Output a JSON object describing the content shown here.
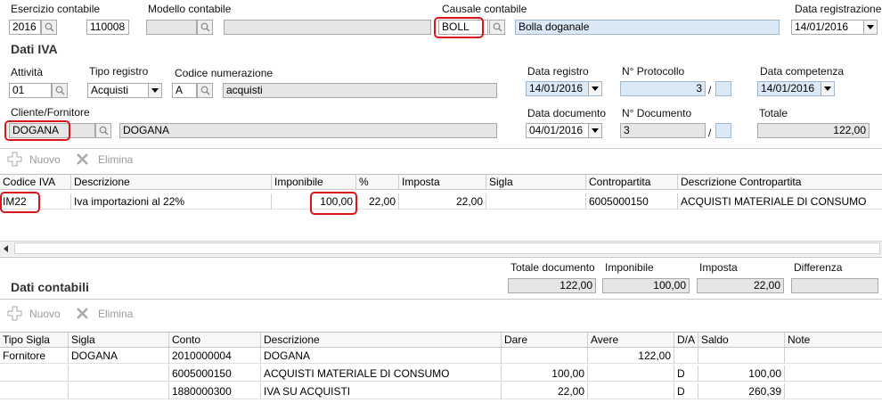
{
  "header": {
    "esercizio_label": "Esercizio contabile",
    "esercizio_value": "2016",
    "esercizio_code": "110008",
    "modello_label": "Modello contabile",
    "modello_value": "",
    "modello_desc": "",
    "causale_label": "Causale contabile",
    "causale_value": "BOLL",
    "causale_desc": "Bolla doganale",
    "data_reg_label": "Data registrazione",
    "data_reg_value": "14/01/2016"
  },
  "iva": {
    "title": "Dati IVA",
    "attivita_label": "Attività",
    "attivita_value": "01",
    "tipo_registro_label": "Tipo registro",
    "tipo_registro_value": "Acquisti",
    "codice_num_label": "Codice numerazione",
    "codice_num_value": "A",
    "codice_num_desc": "acquisti",
    "data_registro_label": "Data registro",
    "data_registro_value": "14/01/2016",
    "protocollo_label": "N° Protocollo",
    "protocollo_value": "3",
    "protocollo_sep": "/",
    "data_comp_label": "Data competenza",
    "data_comp_value": "14/01/2016",
    "cliente_label": "Cliente/Fornitore",
    "cliente_value": "DOGANA",
    "cliente_desc": "DOGANA",
    "data_doc_label": "Data documento",
    "data_doc_value": "04/01/2016",
    "num_doc_label": "N° Documento",
    "num_doc_value": "3",
    "num_doc_sep": "/",
    "totale_label": "Totale",
    "totale_value": "122,00"
  },
  "toolbar1": {
    "nuovo": "Nuovo",
    "elimina": "Elimina"
  },
  "iva_grid": {
    "columns": [
      "Codice IVA",
      "Descrizione",
      "Imponibile",
      "%",
      "Imposta",
      "Sigla",
      "Contropartita",
      "Descrizione Contropartita"
    ],
    "rows": [
      [
        "IM22",
        "Iva importazioni al 22%",
        "100,00",
        "22,00",
        "22,00",
        "",
        "6005000150",
        "ACQUISTI MATERIALE DI CONSUMO"
      ]
    ]
  },
  "totals": {
    "totale_doc_label": "Totale documento",
    "totale_doc_value": "122,00",
    "imponibile_label": "Imponibile",
    "imponibile_value": "100,00",
    "imposta_label": "Imposta",
    "imposta_value": "22,00",
    "differenza_label": "Differenza",
    "differenza_value": ""
  },
  "contabili": {
    "title": "Dati contabili"
  },
  "toolbar2": {
    "nuovo": "Nuovo",
    "elimina": "Elimina"
  },
  "cont_grid": {
    "columns": [
      "Tipo Sigla",
      "Sigla",
      "Conto",
      "Descrizione",
      "Dare",
      "Avere",
      "D/A",
      "Saldo",
      "Note"
    ],
    "rows": [
      [
        "Fornitore",
        "DOGANA",
        "2010000004",
        "DOGANA",
        "",
        "122,00",
        "",
        "",
        ""
      ],
      [
        "",
        "",
        "6005000150",
        "ACQUISTI MATERIALE DI CONSUMO",
        "100,00",
        "",
        "D",
        "100,00",
        ""
      ],
      [
        "",
        "",
        "1880000300",
        "IVA SU ACQUISTI",
        "22,00",
        "",
        "D",
        "260,39",
        ""
      ]
    ]
  }
}
